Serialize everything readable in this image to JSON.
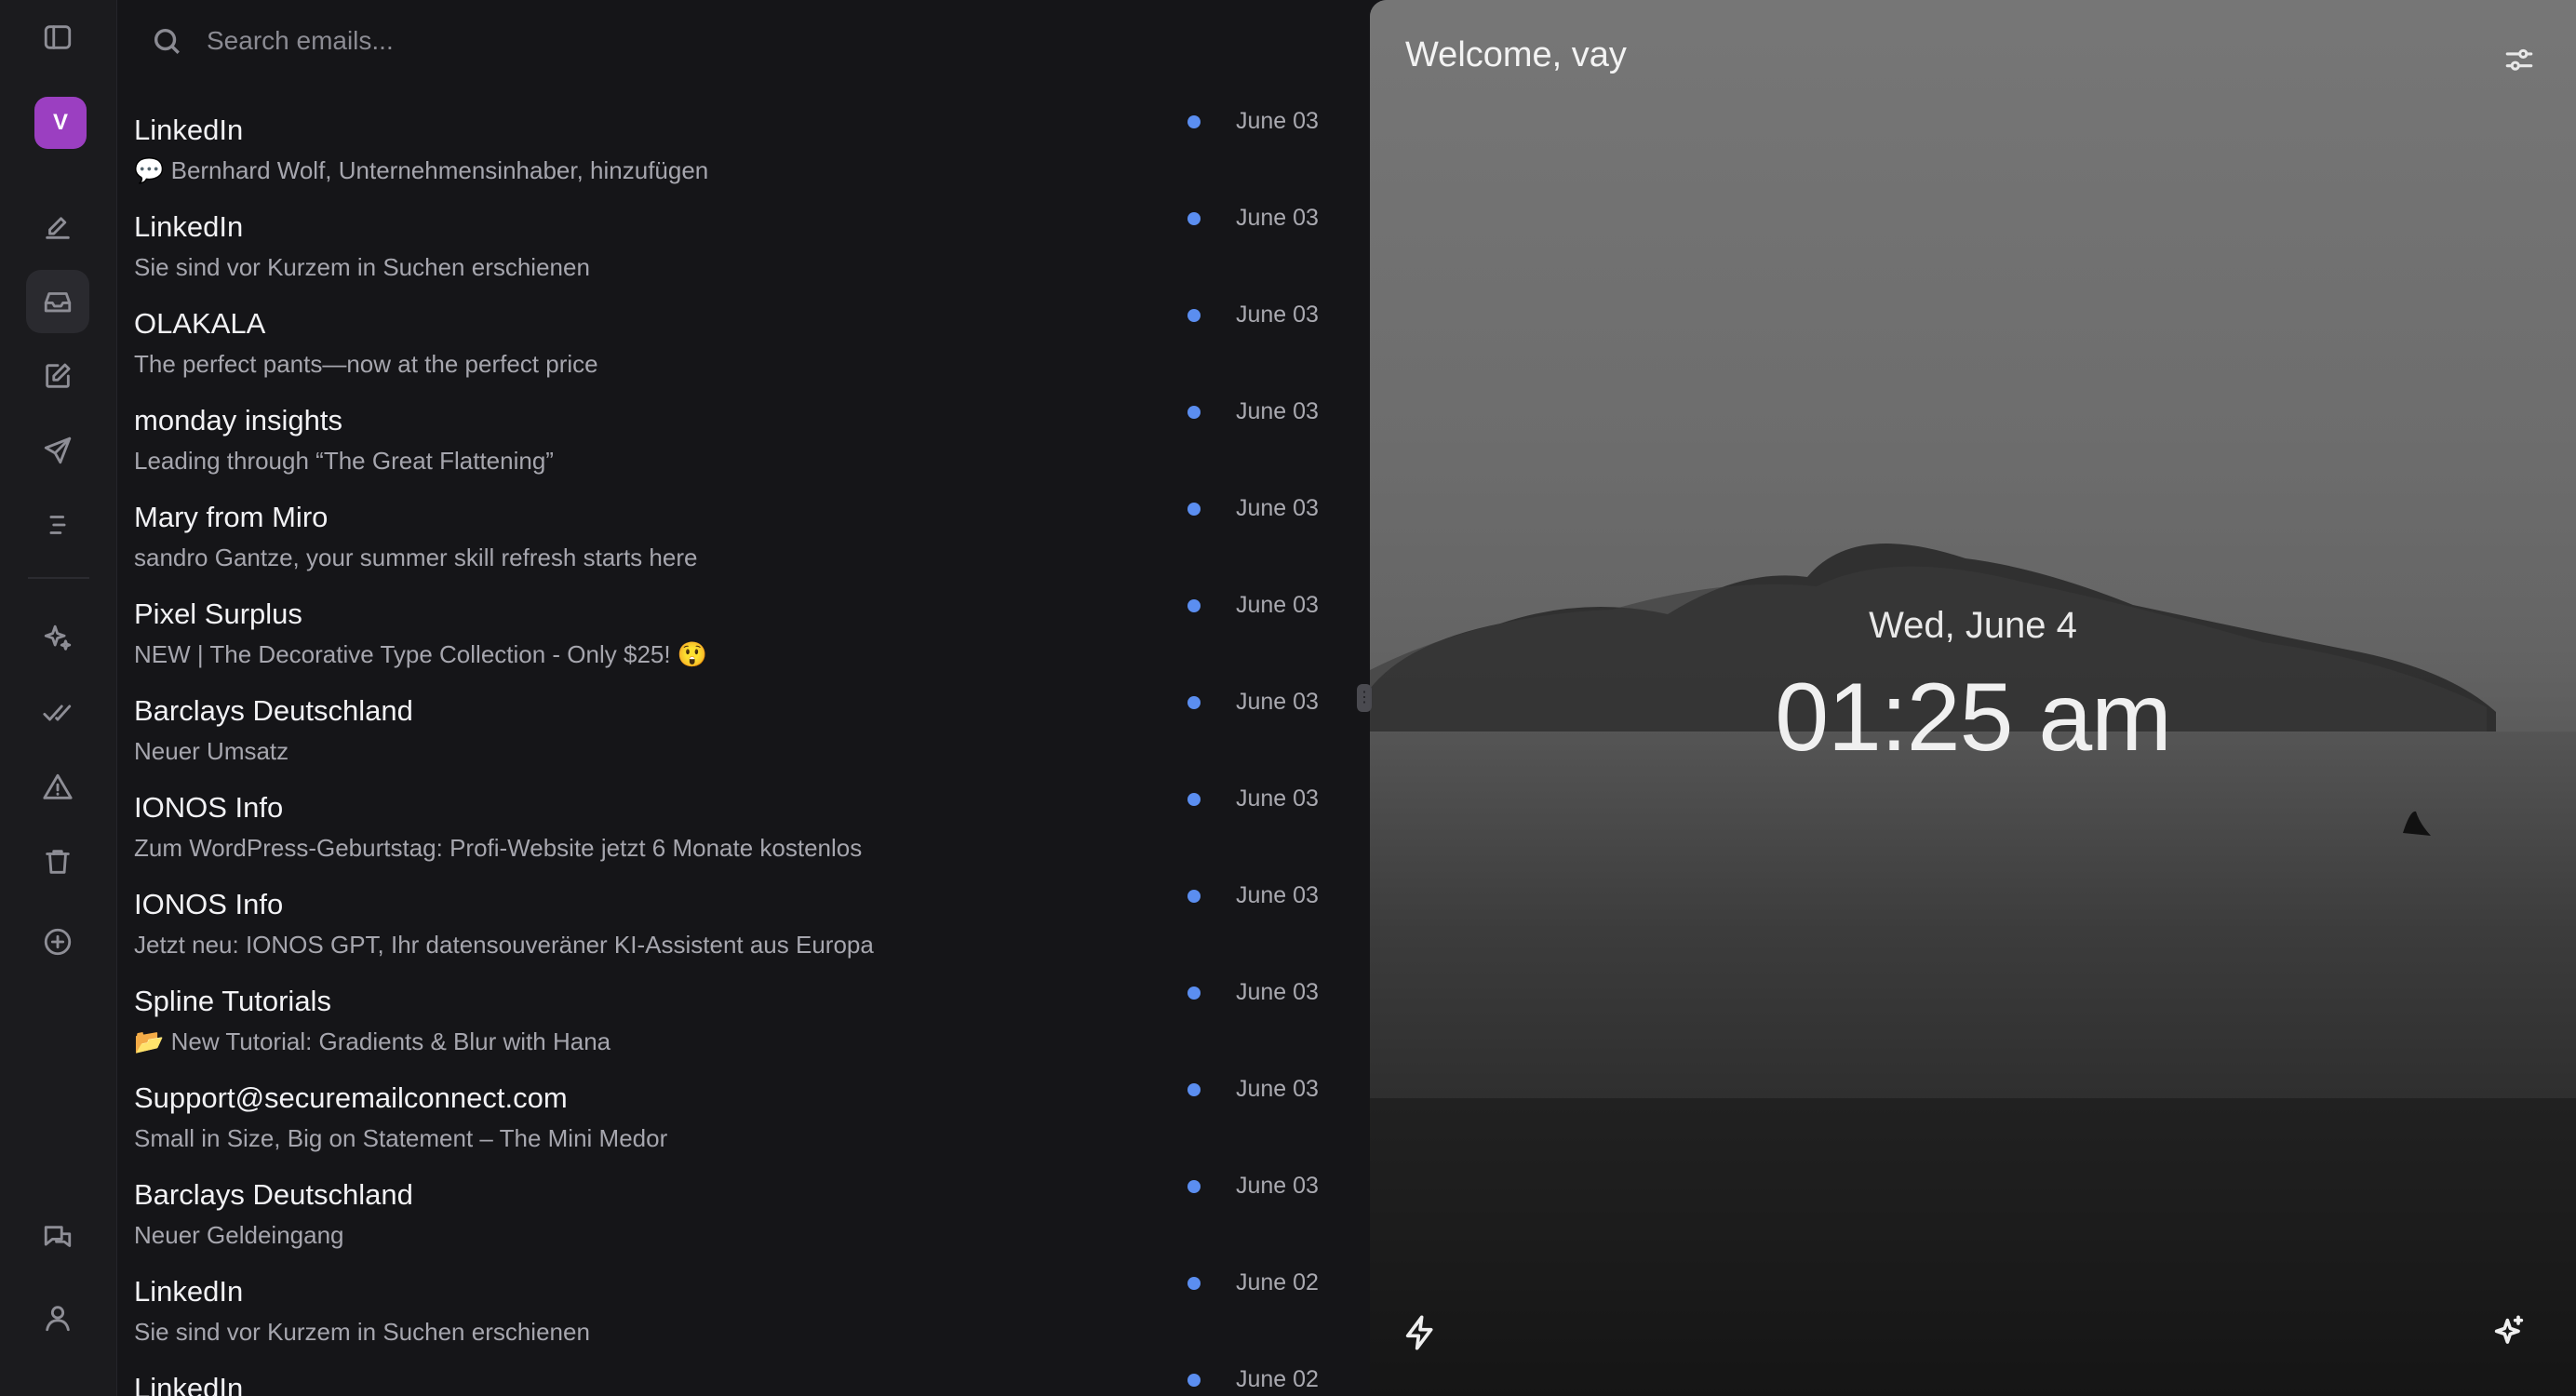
{
  "search": {
    "placeholder": "Search emails..."
  },
  "sidebar": {
    "avatar_letter": "V",
    "icons": [
      "sidebar-toggle-icon",
      "compose-icon",
      "inbox-icon",
      "drafts-icon",
      "send-icon",
      "list-icon",
      "sparkle-icon",
      "double-check-icon",
      "warning-icon",
      "trash-icon",
      "add-circle-icon",
      "chat-icon",
      "user-icon"
    ],
    "active": "inbox-icon"
  },
  "emails": [
    {
      "sender": "LinkedIn",
      "subject": "💬 Bernhard Wolf, Unternehmensinhaber, hinzufügen",
      "date": "June 03",
      "unread": true
    },
    {
      "sender": "LinkedIn",
      "subject": "Sie sind vor Kurzem in Suchen erschienen",
      "date": "June 03",
      "unread": true
    },
    {
      "sender": "OLAKALA",
      "subject": "The perfect pants—now at the perfect price",
      "date": "June 03",
      "unread": true
    },
    {
      "sender": "monday insights",
      "subject": "Leading through “The Great Flattening”",
      "date": "June 03",
      "unread": true
    },
    {
      "sender": "Mary from Miro",
      "subject": "sandro Gantze, your summer skill refresh starts here",
      "date": "June 03",
      "unread": true
    },
    {
      "sender": "Pixel Surplus",
      "subject": "NEW | The Decorative Type Collection - Only $25! 😲",
      "date": "June 03",
      "unread": true
    },
    {
      "sender": "Barclays Deutschland",
      "subject": "Neuer Umsatz",
      "date": "June 03",
      "unread": true
    },
    {
      "sender": "IONOS Info",
      "subject": "Zum WordPress-Geburtstag: Profi-Website jetzt 6 Monate kostenlos",
      "date": "June 03",
      "unread": true
    },
    {
      "sender": "IONOS Info",
      "subject": "Jetzt neu: IONOS GPT, Ihr datensouveräner KI-Assistent aus Europa",
      "date": "June 03",
      "unread": true
    },
    {
      "sender": "Spline Tutorials",
      "subject": "📂 New Tutorial: Gradients & Blur with Hana",
      "date": "June 03",
      "unread": true
    },
    {
      "sender": "Support@securemailconnect.com",
      "subject": "Small in Size, Big on Statement – The Mini Medor",
      "date": "June 03",
      "unread": true
    },
    {
      "sender": "Barclays Deutschland",
      "subject": "Neuer Geldeingang",
      "date": "June 03",
      "unread": true
    },
    {
      "sender": "LinkedIn",
      "subject": "Sie sind vor Kurzem in Suchen erschienen",
      "date": "June 02",
      "unread": true
    },
    {
      "sender": "LinkedIn",
      "subject": "",
      "date": "June 02",
      "unread": true
    }
  ],
  "hero": {
    "welcome": "Welcome, vay",
    "date": "Wed, June 4",
    "time": "01:25 am"
  },
  "colors": {
    "accent_dot": "#5b8ef0",
    "avatar": "#9b3fc1"
  }
}
